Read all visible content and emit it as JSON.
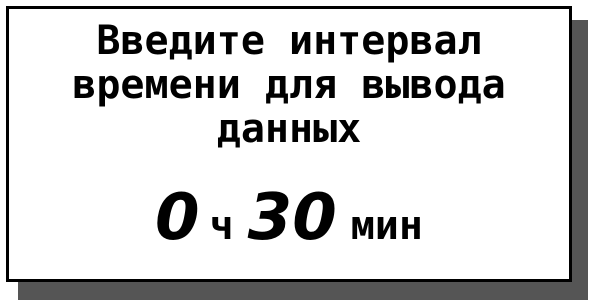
{
  "prompt": {
    "line1": "Введите интервал",
    "line2": "времени для вывода",
    "line3": "данных"
  },
  "interval": {
    "hours_value": "0",
    "hours_unit": "ч",
    "minutes_value": "30",
    "minutes_unit": "мин"
  }
}
